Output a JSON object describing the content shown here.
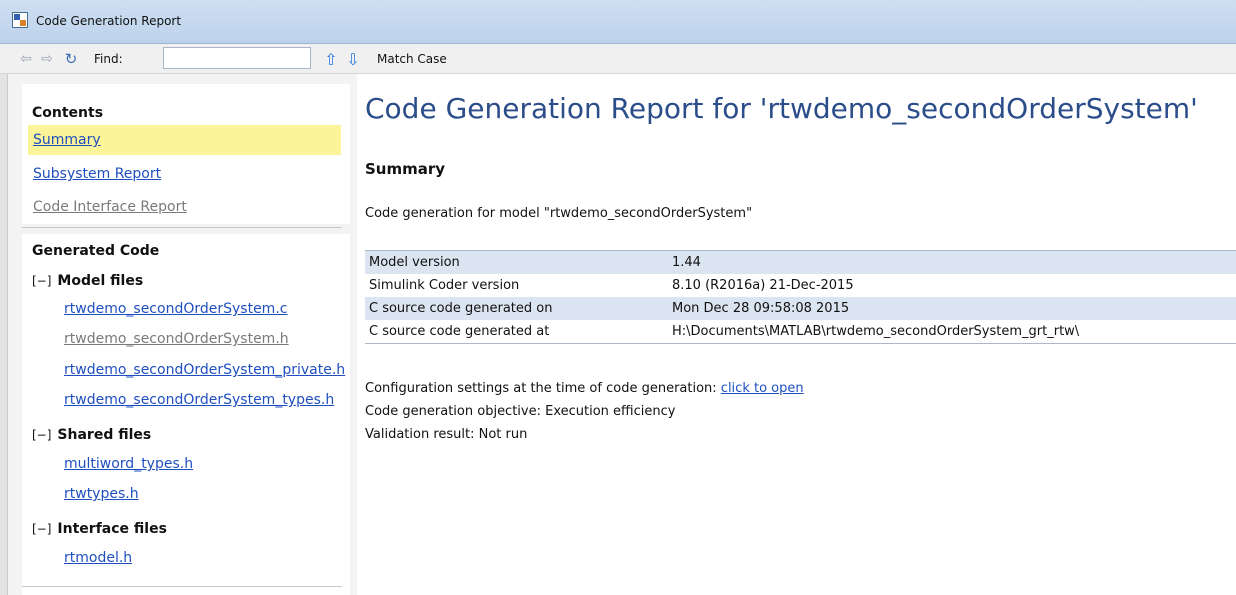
{
  "window": {
    "title": "Code Generation Report"
  },
  "toolbar": {
    "find_label": "Find:",
    "find_value": "",
    "match_case_label": "Match Case"
  },
  "sidebar": {
    "contents_header": "Contents",
    "contents_items": [
      {
        "label": "Summary",
        "state": "active"
      },
      {
        "label": "Subsystem Report",
        "state": "link"
      },
      {
        "label": "Code Interface Report",
        "state": "muted"
      }
    ],
    "generated_header": "Generated Code",
    "toggle_symbol": "[−]",
    "groups": [
      {
        "label": "Model files",
        "files": [
          {
            "name": "rtwdemo_secondOrderSystem.c",
            "state": "link"
          },
          {
            "name": "rtwdemo_secondOrderSystem.h",
            "state": "muted"
          },
          {
            "name": "rtwdemo_secondOrderSystem_private.h",
            "state": "link"
          },
          {
            "name": "rtwdemo_secondOrderSystem_types.h",
            "state": "link"
          }
        ]
      },
      {
        "label": "Shared files",
        "files": [
          {
            "name": "multiword_types.h",
            "state": "link"
          },
          {
            "name": "rtwtypes.h",
            "state": "link"
          }
        ]
      },
      {
        "label": "Interface files",
        "files": [
          {
            "name": "rtmodel.h",
            "state": "link"
          }
        ]
      }
    ]
  },
  "main": {
    "title": "Code Generation Report for 'rtwdemo_secondOrderSystem'",
    "section_title": "Summary",
    "intro": "Code generation for model \"rtwdemo_secondOrderSystem\"",
    "table": [
      {
        "label": "Model version",
        "value": "1.44"
      },
      {
        "label": "Simulink Coder version",
        "value": "8.10 (R2016a) 21-Dec-2015"
      },
      {
        "label": "C source code generated on",
        "value": "Mon Dec 28 09:58:08 2015"
      },
      {
        "label": "C source code generated at",
        "value": "H:\\Documents\\MATLAB\\rtwdemo_secondOrderSystem_grt_rtw\\"
      }
    ],
    "config_text": "Configuration settings at the time of code generation: ",
    "config_link": "click to open",
    "objective": "Code generation objective: Execution efficiency",
    "validation": "Validation result: Not run"
  },
  "colors": {
    "link": "#1f4fbf",
    "title_blue": "#2b4d8a",
    "highlight": "#fbf499",
    "row_shade": "#dbe5f1"
  }
}
